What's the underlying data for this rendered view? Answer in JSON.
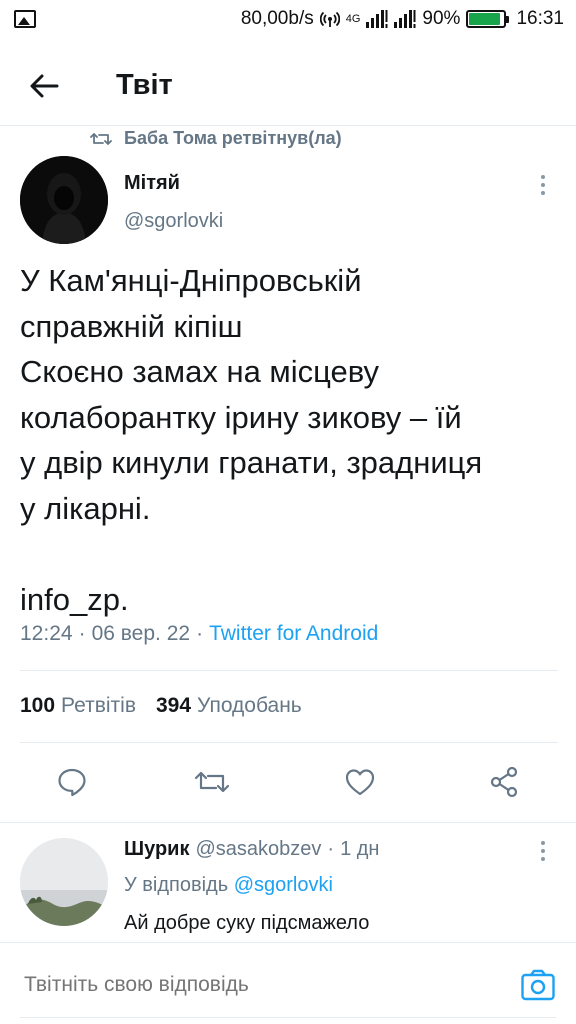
{
  "status_bar": {
    "speed": "80,00b/s",
    "network": "4G",
    "battery": "90%",
    "battery_level": 0.9,
    "time": "16:31"
  },
  "header": {
    "title": "Твіт"
  },
  "retweet_context": "Баба Тома ретвітнув(ла)",
  "tweet": {
    "author_name": "Мітяй",
    "author_handle": "@sgorlovki",
    "text": "У Кам'янці-Дніпровській\nсправжній кіпіш\nСкоєно замах на місцеву\nколаборантку ірину зикову – їй\nу двір кинули гранати, зрадниця\nу лікарні.\n\ninfo_zp.",
    "time": "12:24",
    "date": "06 вер. 22",
    "source": "Twitter for Android",
    "sep": "·"
  },
  "stats": {
    "retweets_count": "100",
    "retweets_label": "Ретвітів",
    "likes_count": "394",
    "likes_label": "Уподобань"
  },
  "reply": {
    "name": "Шурик",
    "handle": "@sasakobzev",
    "sep": "·",
    "time": "1 дн",
    "reply_to_prefix": "У відповідь",
    "reply_to_handle": "@sgorlovki",
    "text": "Ай добре суку підсмажело"
  },
  "compose": {
    "placeholder": "Твітніть свою відповідь"
  },
  "colors": {
    "accent": "#1da1f2",
    "secondary_text": "#657786",
    "battery": "#19a34a"
  }
}
